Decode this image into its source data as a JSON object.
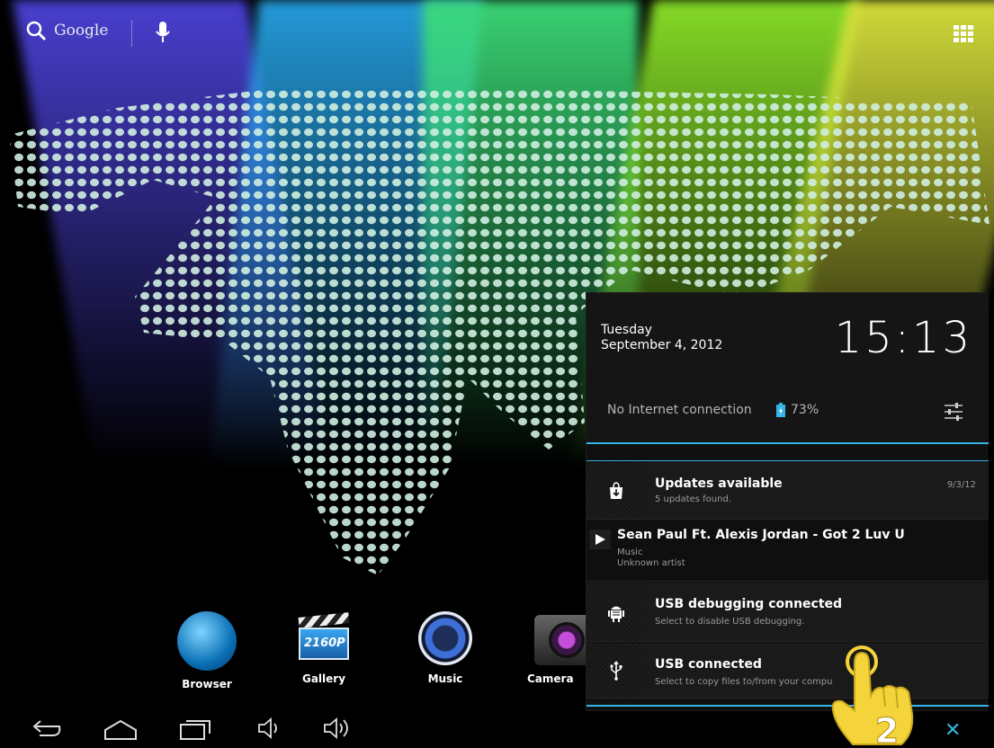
{
  "search": {
    "label": "Google"
  },
  "dock": {
    "apps": [
      {
        "label": "Browser"
      },
      {
        "label": "Gallery",
        "badge": "2160P"
      },
      {
        "label": "Music"
      },
      {
        "label": "Camera"
      }
    ]
  },
  "panel": {
    "day": "Tuesday",
    "date": "September 4, 2012",
    "clock": "15:13",
    "network_status": "No Internet connection",
    "battery_percent": "73%",
    "notifications": [
      {
        "title": "Updates available",
        "subtitle": "5 updates found.",
        "time": "9/3/12",
        "icon": "store-icon"
      },
      {
        "title": "Sean Paul Ft. Alexis Jordan - Got 2 Luv U",
        "subtitle": "Music",
        "subtitle2": "Unknown artist",
        "icon": "play-icon"
      },
      {
        "title": "USB debugging connected",
        "subtitle": "Select to disable USB debugging.",
        "icon": "android-debug-icon"
      },
      {
        "title": "USB connected",
        "subtitle": "Select to copy files to/from your compu",
        "icon": "usb-icon"
      }
    ]
  },
  "overlay": {
    "step_number": "2"
  },
  "colors": {
    "accent": "#33b5e5",
    "panel_bg": "#101010",
    "hand": "#f5d33a"
  }
}
